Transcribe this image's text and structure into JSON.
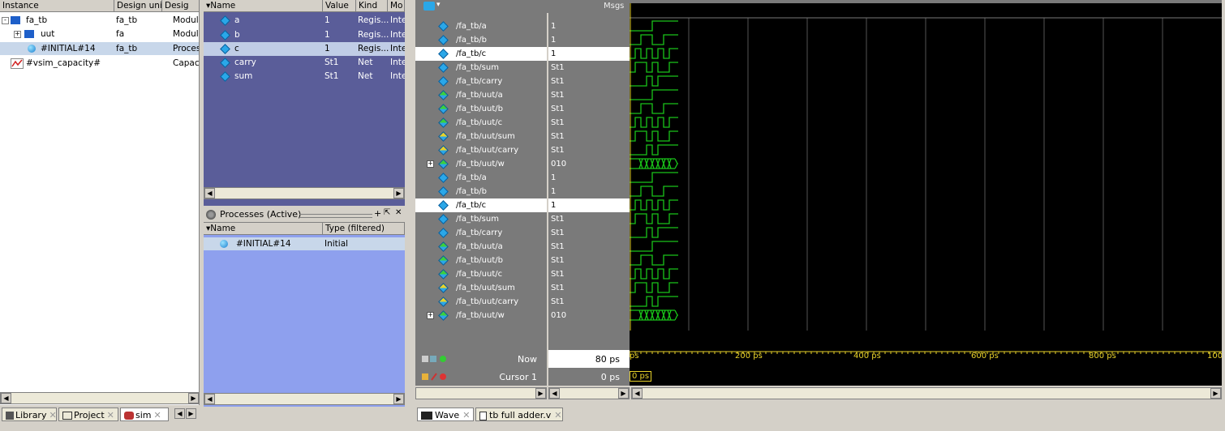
{
  "instance_pane": {
    "columns": [
      "Instance",
      "Design unit",
      "Desig"
    ],
    "rows": [
      {
        "name": "fa_tb",
        "unit": "fa_tb",
        "type": "Modul"
      },
      {
        "name": "uut",
        "unit": "fa",
        "type": "Modul"
      },
      {
        "name": "#INITIAL#14",
        "unit": "fa_tb",
        "type": "Proces"
      },
      {
        "name": "#vsim_capacity#",
        "unit": "",
        "type": "Capac"
      }
    ]
  },
  "objects_pane": {
    "columns": [
      "Name",
      "Value",
      "Kind",
      "Mo"
    ],
    "rows": [
      {
        "name": "a",
        "value": "1",
        "kind": "Regis...",
        "mode": "Inte"
      },
      {
        "name": "b",
        "value": "1",
        "kind": "Regis...",
        "mode": "Inte"
      },
      {
        "name": "c",
        "value": "1",
        "kind": "Regis...",
        "mode": "Inte"
      },
      {
        "name": "carry",
        "value": "St1",
        "kind": "Net",
        "mode": "Inte"
      },
      {
        "name": "sum",
        "value": "St1",
        "kind": "Net",
        "mode": "Inte"
      }
    ]
  },
  "processes_pane": {
    "title": "Processes (Active)",
    "columns": [
      "Name",
      "Type (filtered)"
    ],
    "rows": [
      {
        "name": "#INITIAL#14",
        "type": "Initial"
      }
    ]
  },
  "wave_pane": {
    "msgs_label": "Msgs",
    "signals": [
      {
        "name": "/fa_tb/a",
        "value": "1"
      },
      {
        "name": "/fa_tb/b",
        "value": "1"
      },
      {
        "name": "/fa_tb/c",
        "value": "1"
      },
      {
        "name": "/fa_tb/sum",
        "value": "St1"
      },
      {
        "name": "/fa_tb/carry",
        "value": "St1"
      },
      {
        "name": "/fa_tb/uut/a",
        "value": "St1"
      },
      {
        "name": "/fa_tb/uut/b",
        "value": "St1"
      },
      {
        "name": "/fa_tb/uut/c",
        "value": "St1"
      },
      {
        "name": "/fa_tb/uut/sum",
        "value": "St1"
      },
      {
        "name": "/fa_tb/uut/carry",
        "value": "St1"
      },
      {
        "name": "/fa_tb/uut/w",
        "value": "010"
      },
      {
        "name": "/fa_tb/a",
        "value": "1"
      },
      {
        "name": "/fa_tb/b",
        "value": "1"
      },
      {
        "name": "/fa_tb/c",
        "value": "1"
      },
      {
        "name": "/fa_tb/sum",
        "value": "St1"
      },
      {
        "name": "/fa_tb/carry",
        "value": "St1"
      },
      {
        "name": "/fa_tb/uut/a",
        "value": "St1"
      },
      {
        "name": "/fa_tb/uut/b",
        "value": "St1"
      },
      {
        "name": "/fa_tb/uut/c",
        "value": "St1"
      },
      {
        "name": "/fa_tb/uut/sum",
        "value": "St1"
      },
      {
        "name": "/fa_tb/uut/carry",
        "value": "St1"
      },
      {
        "name": "/fa_tb/uut/w",
        "value": "010"
      }
    ],
    "now_label": "Now",
    "now_value": "80 ps",
    "cursor_label": "Cursor 1",
    "cursor_value": "0 ps",
    "cursor_marker": "0 ps",
    "timeline": [
      "ps",
      "200 ps",
      "400 ps",
      "600 ps",
      "800 ps",
      "100"
    ]
  },
  "bottom_tabs_left": [
    "Library",
    "Project",
    "sim"
  ],
  "bottom_tabs_right": [
    "Wave",
    "tb full adder.v"
  ],
  "colors": {
    "wave": "#19c419",
    "objects_bg": "#5a5d99",
    "process_bg": "#8ea0ee"
  }
}
